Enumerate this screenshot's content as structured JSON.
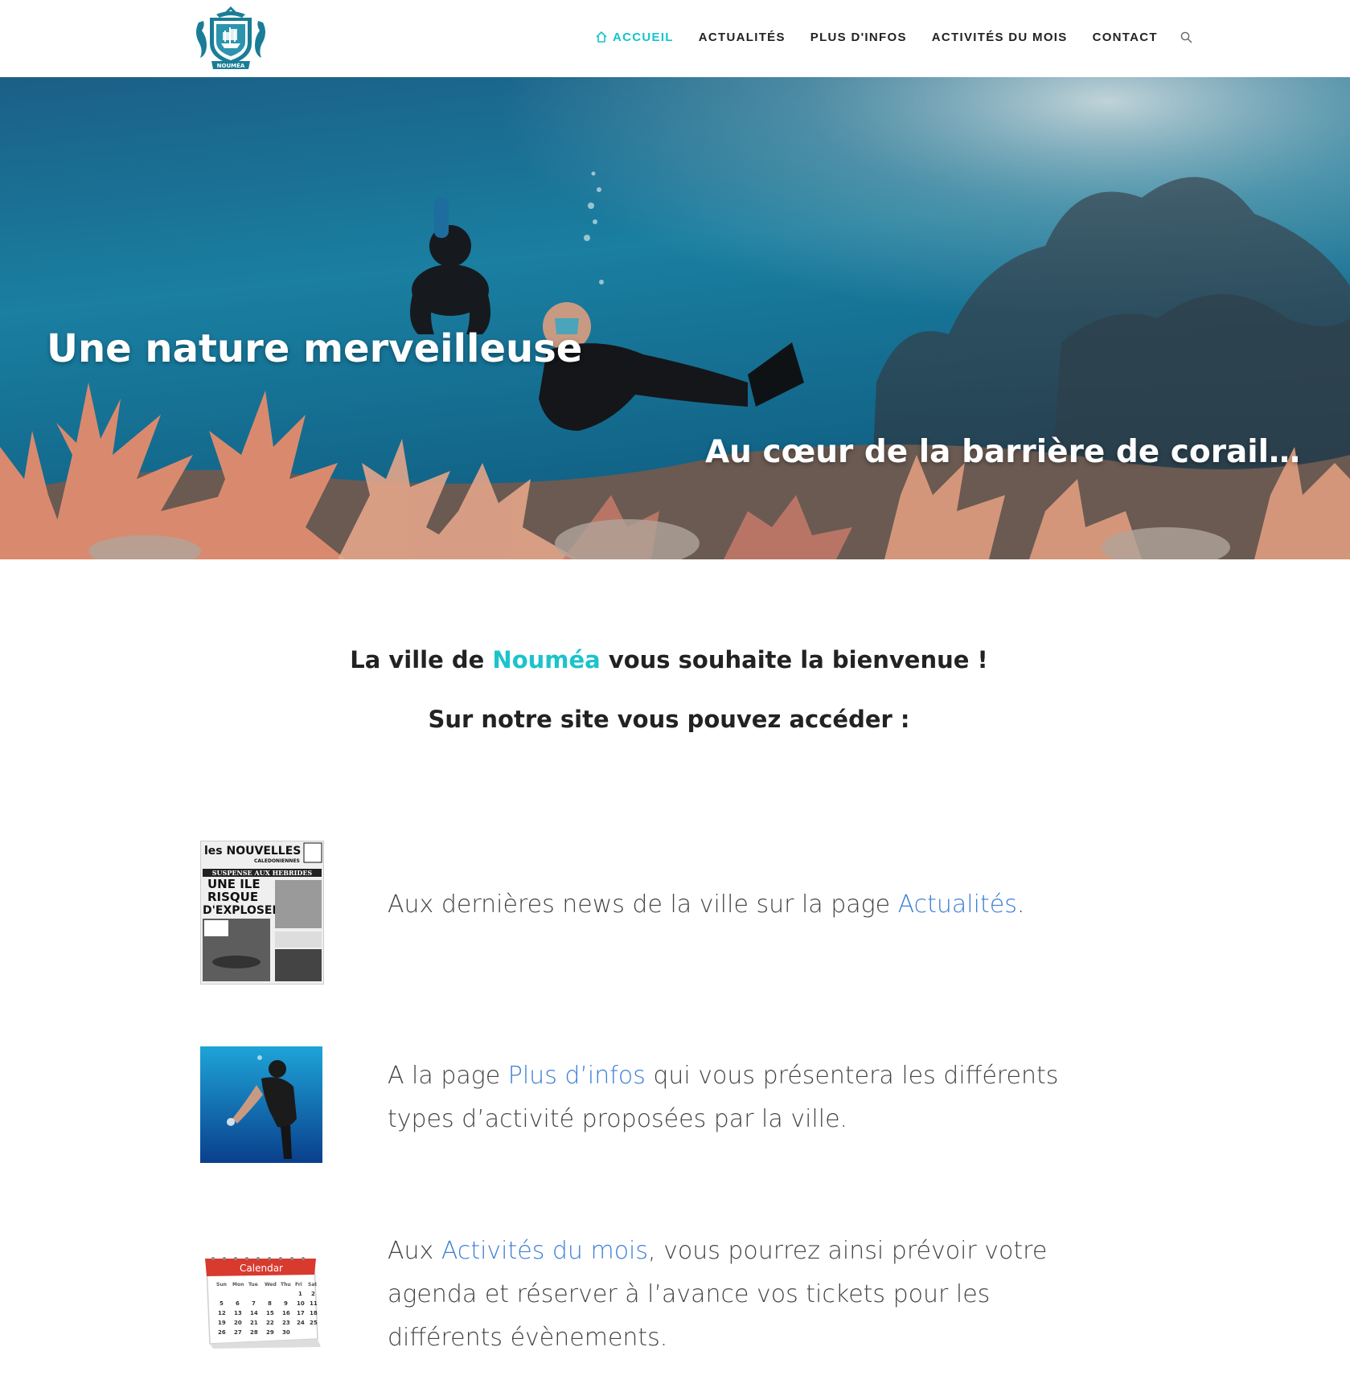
{
  "header": {
    "logo_alt": "NOUMÉA",
    "nav": [
      {
        "label": "ACCUEIL",
        "icon": "home-icon",
        "active": true
      },
      {
        "label": "ACTUALITÉS",
        "active": false
      },
      {
        "label": "PLUS D'INFOS",
        "active": false
      },
      {
        "label": "ACTIVITÉS DU MOIS",
        "active": false
      },
      {
        "label": "CONTACT",
        "active": false
      }
    ],
    "search_icon": "search-icon"
  },
  "hero": {
    "title": "Une nature merveilleuse",
    "subtitle": "Au cœur de la barrière de corail…"
  },
  "intro": {
    "welcome_before": "La ville de ",
    "welcome_highlight": "Nouméa",
    "welcome_after": " vous souhaite la bienvenue !",
    "access": "Sur notre site vous pouvez accéder :"
  },
  "features": [
    {
      "thumb": "newspaper-image",
      "newspaper": {
        "masthead": "les NOUVELLES",
        "sub": "CALEDONIENNES",
        "banner": "SUSPENSE AUX HEBRIDES",
        "headline_1": "UNE ILE",
        "headline_2": "RISQUE",
        "headline_3": "D'EXPLOSER"
      },
      "before": "Aux dernières news de la ville sur la page ",
      "link": "Actualités",
      "after": "."
    },
    {
      "thumb": "diver-image",
      "before": "A la page ",
      "link": "Plus d’infos",
      "after": " qui vous présentera les différents types d’activité proposées par la ville."
    },
    {
      "thumb": "calendar-image",
      "calendar_label": "Calendar",
      "before": "Aux ",
      "link": "Activités du mois",
      "after": ", vous pourrez ainsi prévoir votre agenda et réserver à l’avance vos tickets pour les différents évènements."
    }
  ],
  "colors": {
    "accent": "#13c4cf",
    "link": "#3d7fd6",
    "text": "#444444",
    "logo": "#1a7d97"
  }
}
